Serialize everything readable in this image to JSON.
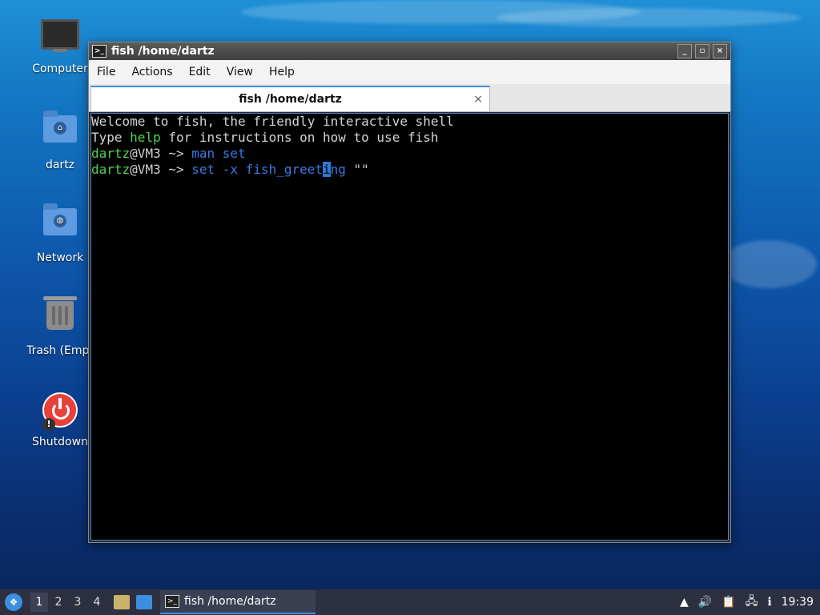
{
  "desktop": {
    "icons": [
      {
        "label": "Computer",
        "icon": "computer-icon"
      },
      {
        "label": "dartz",
        "icon": "home-folder-icon"
      },
      {
        "label": "Network",
        "icon": "network-folder-icon"
      },
      {
        "label": "Trash (Empt",
        "icon": "trash-icon"
      },
      {
        "label": "Shutdown",
        "icon": "power-icon"
      }
    ]
  },
  "window": {
    "title": "fish /home/dartz",
    "menu": [
      "File",
      "Actions",
      "Edit",
      "View",
      "Help"
    ],
    "tab_label": "fish /home/dartz",
    "tab_close": "×",
    "buttons": {
      "minimize": "_",
      "maximize": "▫",
      "close": "×"
    }
  },
  "terminal": {
    "line1": "Welcome to fish, the friendly interactive shell",
    "line2_pre": "Type ",
    "line2_help": "help",
    "line2_post": " for instructions on how to use fish",
    "prompt_user": "dartz",
    "prompt_host": "@VM3",
    "prompt_path": " ~> ",
    "cmd1_a": "man",
    "cmd1_b": " set",
    "cmd2_a": "set -x fish_greet",
    "cmd2_cursor": "i",
    "cmd2_b": "ng ",
    "cmd2_c": "\"\""
  },
  "taskbar": {
    "workspaces": [
      "1",
      "2",
      "3",
      "4"
    ],
    "active_workspace": "1",
    "task_label": "fish /home/dartz",
    "clock": "19:39"
  },
  "colors": {
    "accent": "#3d8ee0",
    "prompt_green": "#4fd44f",
    "command_blue": "#3a78e0"
  }
}
